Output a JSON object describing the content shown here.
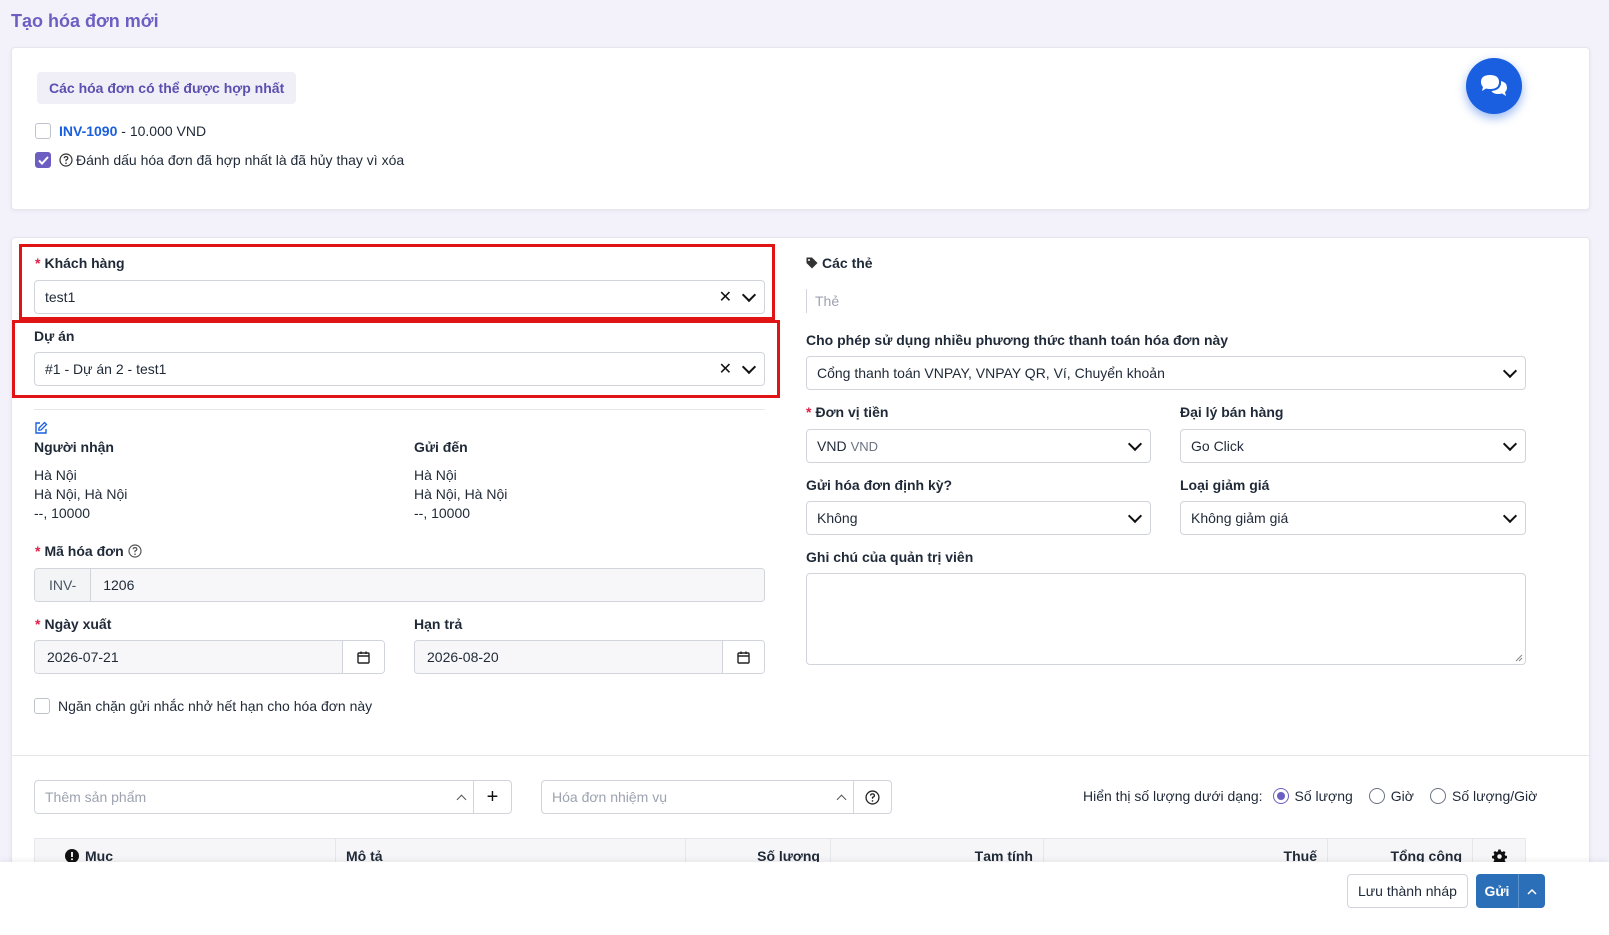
{
  "page": {
    "title": "Tạo hóa đơn mới"
  },
  "merge": {
    "heading": "Các hóa đơn có thể được hợp nhất",
    "invoice_ref": "INV-1090",
    "invoice_amount": " - 10.000 VND",
    "mark_cancelled_label": "Đánh dấu hóa đơn đã hợp nhất là đã hủy thay vì xóa"
  },
  "customer": {
    "label": "Khách hàng",
    "value": "test1"
  },
  "project": {
    "label": "Dự án",
    "value": "#1 - Dự án 2 - test1"
  },
  "address": {
    "recipient": {
      "title": "Người nhận",
      "line1": "Hà Nội",
      "line2": "Hà Nội, Hà Nội",
      "line3": "--, 10000"
    },
    "ship_to": {
      "title": "Gửi đến",
      "line1": "Hà Nội",
      "line2": "Hà Nội, Hà Nội",
      "line3": "--, 10000"
    }
  },
  "invoice_number": {
    "label": "Mã hóa đơn",
    "prefix": "INV-",
    "value": "1206"
  },
  "issue_date": {
    "label": "Ngày xuất",
    "value": "2026-07-21"
  },
  "due_date": {
    "label": "Hạn trả",
    "value": "2026-08-20"
  },
  "prevent_reminder_label": "Ngăn chặn gửi nhắc nhở hết hạn cho hóa đơn này",
  "tags": {
    "label": "Các thẻ",
    "placeholder": "Thẻ"
  },
  "payment_modes": {
    "label": "Cho phép sử dụng nhiều phương thức thanh toán hóa đơn này",
    "value": "Cổng thanh toán VNPAY, VNPAY QR, Ví, Chuyển khoản"
  },
  "currency": {
    "label": "Đơn vị tiền",
    "value": "VND",
    "sub": "VND"
  },
  "sale_agent": {
    "label": "Đại lý bán hàng",
    "value": "Go Click"
  },
  "recurring": {
    "label": "Gửi hóa đơn định kỳ?",
    "value": "Không"
  },
  "discount_type": {
    "label": "Loại giảm giá",
    "value": "Không giảm giá"
  },
  "admin_note": {
    "label": "Ghi chú của quản trị viên"
  },
  "items": {
    "add_product_placeholder": "Thêm sản phẩm",
    "task_invoice_placeholder": "Hóa đơn nhiệm vụ",
    "qty_display_label": "Hiển thị số lượng dưới dạng:",
    "qty_options": [
      "Số lượng",
      "Giờ",
      "Số lượng/Giờ"
    ],
    "qty_selected": "Số lượng",
    "columns": [
      "Mục",
      "Mô tả",
      "Số lượng",
      "Tạm tính",
      "Thuế",
      "Tổng cộng"
    ]
  },
  "footer": {
    "save_draft": "Lưu thành nháp",
    "send": "Gửi"
  },
  "colors": {
    "accent": "#6d5fc2",
    "primary": "#1a5fe0",
    "highlight": "#e01414"
  }
}
